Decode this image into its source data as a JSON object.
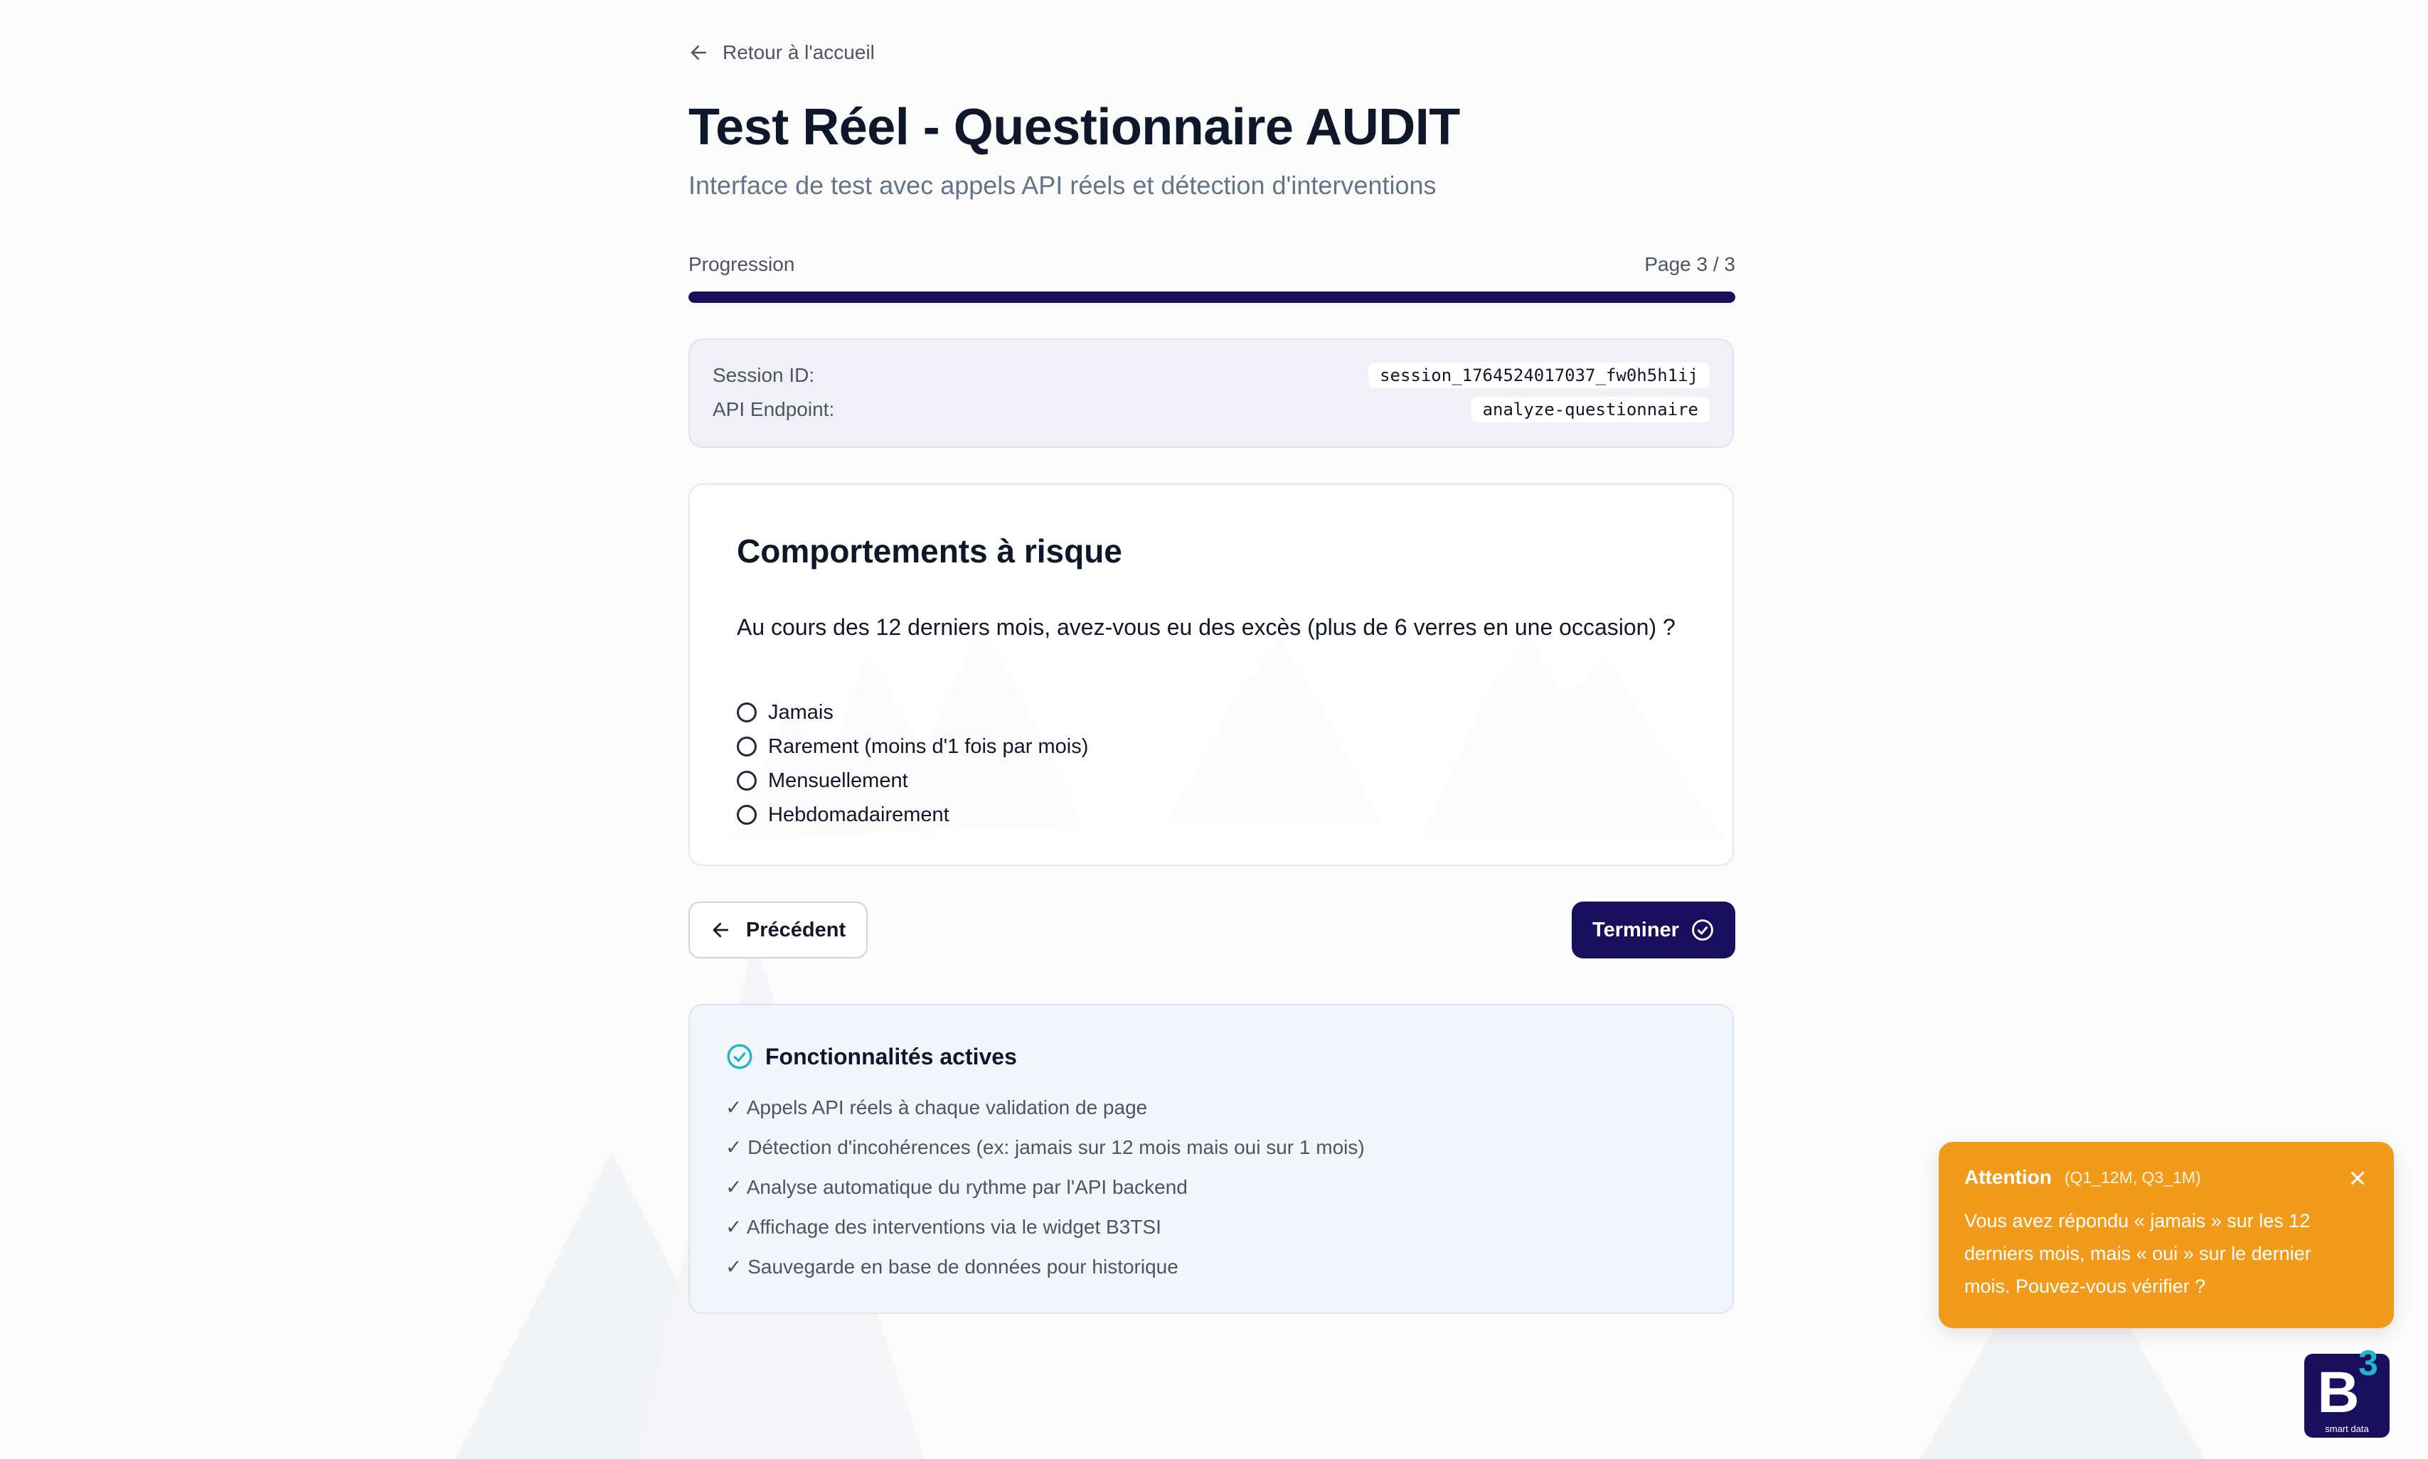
{
  "nav": {
    "back_label": "Retour à l'accueil"
  },
  "header": {
    "title": "Test Réel - Questionnaire AUDIT",
    "subtitle": "Interface de test avec appels API réels et détection d'interventions"
  },
  "progress": {
    "label": "Progression",
    "page_text": "Page 3 / 3",
    "fraction": 1.0,
    "color": "#1a0f5c"
  },
  "session": {
    "session_label": "Session ID:",
    "session_value": "session_1764524017037_fw0h5h1ij",
    "endpoint_label": "API Endpoint:",
    "endpoint_value": "analyze-questionnaire"
  },
  "question_card": {
    "section_title": "Comportements à risque",
    "question": "Au cours des 12 derniers mois, avez-vous eu des excès (plus de 6 verres en une occasion) ?",
    "options": [
      "Jamais",
      "Rarement (moins d'1 fois par mois)",
      "Mensuellement",
      "Hebdomadairement"
    ]
  },
  "actions": {
    "prev_label": "Précédent",
    "finish_label": "Terminer"
  },
  "features": {
    "title": "Fonctionnalités actives",
    "items": [
      "✓ Appels API réels à chaque validation de page",
      "✓ Détection d'incohérences (ex: jamais sur 12 mois mais oui sur 1 mois)",
      "✓ Analyse automatique du rythme par l'API backend",
      "✓ Affichage des interventions via le widget B3TSI",
      "✓ Sauvegarde en base de données pour historique"
    ]
  },
  "toast": {
    "title": "Attention",
    "codes": "(Q1_12M, Q3_1M)",
    "message": "Vous avez répondu « jamais » sur les 12 derniers mois, mais « oui » sur le dernier mois. Pouvez-vous vérifier ?",
    "color": "#f29b1a"
  },
  "logo": {
    "letter": "B",
    "exponent": "3",
    "tagline": "smart data"
  },
  "colors": {
    "accent": "#1a0f5c",
    "text_muted": "#4b5563",
    "teal": "#1fb6c9",
    "warning": "#f29b1a"
  },
  "icons": {
    "back": "arrow-left-icon",
    "finish": "check-circle-icon",
    "features": "check-circle-icon",
    "close": "close-icon"
  }
}
